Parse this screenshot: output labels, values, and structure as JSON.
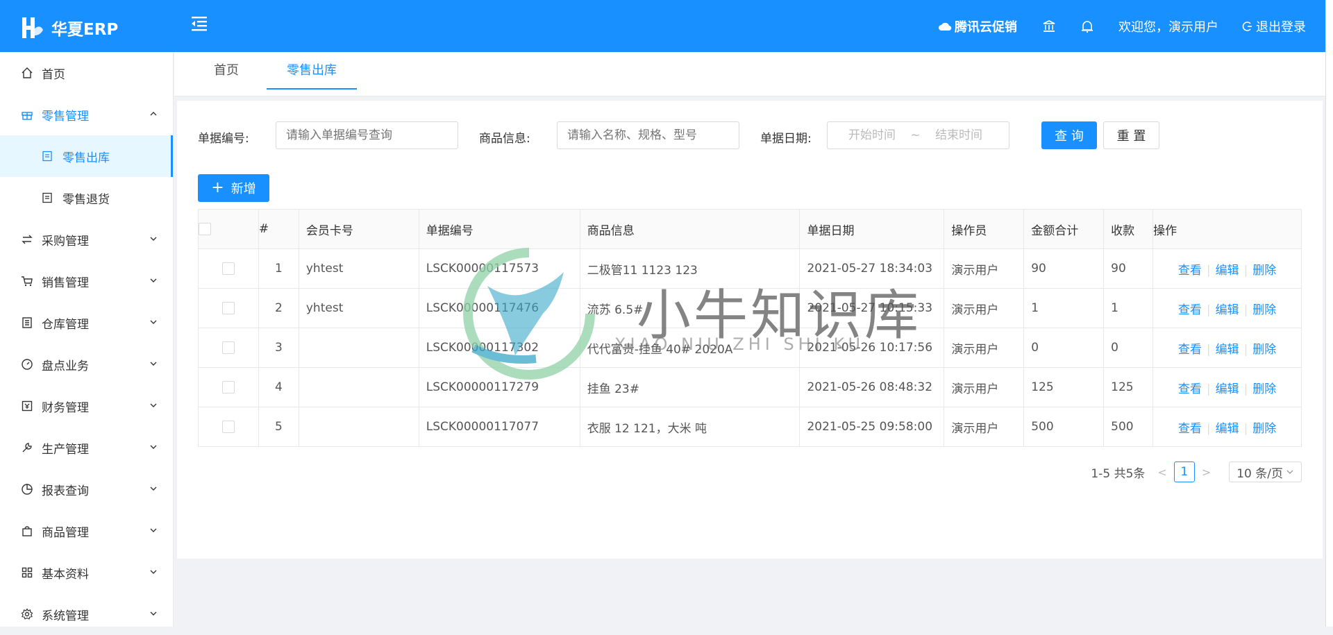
{
  "header": {
    "logo_text": "华夏ERP",
    "promo_label": "腾讯云促销",
    "welcome": "欢迎您，演示用户",
    "logout": "退出登录"
  },
  "sidebar": {
    "items": [
      {
        "label": "首页",
        "icon": "home-icon"
      },
      {
        "label": "零售管理",
        "icon": "gift-icon"
      },
      {
        "label": "零售出库",
        "icon": "doc-icon"
      },
      {
        "label": "零售退货",
        "icon": "doc-icon"
      },
      {
        "label": "采购管理",
        "icon": "swap-icon"
      },
      {
        "label": "销售管理",
        "icon": "cart-icon"
      },
      {
        "label": "仓库管理",
        "icon": "warehouse-icon"
      },
      {
        "label": "盘点业务",
        "icon": "dashboard-icon"
      },
      {
        "label": "财务管理",
        "icon": "finance-icon"
      },
      {
        "label": "生产管理",
        "icon": "wrench-icon"
      },
      {
        "label": "报表查询",
        "icon": "pie-chart-icon"
      },
      {
        "label": "商品管理",
        "icon": "shopping-bag-icon"
      },
      {
        "label": "基本资料",
        "icon": "appstore-icon"
      },
      {
        "label": "系统管理",
        "icon": "setting-icon"
      }
    ]
  },
  "tabs": [
    {
      "label": "首页"
    },
    {
      "label": "零售出库"
    }
  ],
  "filters": {
    "bill_no_label": "单据编号:",
    "bill_no_placeholder": "请输入单据编号查询",
    "goods_label": "商品信息:",
    "goods_placeholder": "请输入名称、规格、型号",
    "date_label": "单据日期:",
    "start_placeholder": "开始时间",
    "date_sep": "~",
    "end_placeholder": "结束时间",
    "query_btn": "查 询",
    "reset_btn": "重 置"
  },
  "add_btn": "新增",
  "table": {
    "columns": [
      "#",
      "会员卡号",
      "单据编号",
      "商品信息",
      "单据日期",
      "操作员",
      "金额合计",
      "收款",
      "操作"
    ],
    "rows": [
      {
        "idx": "1",
        "member": "yhtest",
        "bill": "LSCK00000117573",
        "goods": "二极管11 1123 123",
        "date": "2021-05-27 18:34:03",
        "operator": "演示用户",
        "amount": "90",
        "received": "90"
      },
      {
        "idx": "2",
        "member": "yhtest",
        "bill": "LSCK00000117476",
        "goods": "流苏 6.5#",
        "date": "2021-05-27 10:15:33",
        "operator": "演示用户",
        "amount": "1",
        "received": "1"
      },
      {
        "idx": "3",
        "member": "",
        "bill": "LSCK00000117302",
        "goods": "代代富贵-挂鱼 40# 2020A",
        "date": "2021-05-26 10:17:56",
        "operator": "演示用户",
        "amount": "0",
        "received": "0"
      },
      {
        "idx": "4",
        "member": "",
        "bill": "LSCK00000117279",
        "goods": "挂鱼 23#",
        "date": "2021-05-26 08:48:32",
        "operator": "演示用户",
        "amount": "125",
        "received": "125"
      },
      {
        "idx": "5",
        "member": "",
        "bill": "LSCK00000117077",
        "goods": "衣服 12 121，大米 吨",
        "date": "2021-05-25 09:58:00",
        "operator": "演示用户",
        "amount": "500",
        "received": "500"
      }
    ],
    "op_view": "查看",
    "op_edit": "编辑",
    "op_delete": "删除"
  },
  "pagination": {
    "total": "1-5 共5条",
    "current": "1",
    "page_size": "10 条/页"
  },
  "watermark": {
    "cn": "小牛知识库",
    "en": "XIAO NIU ZHI SHI KU"
  },
  "colors": {
    "primary": "#1890ff"
  }
}
